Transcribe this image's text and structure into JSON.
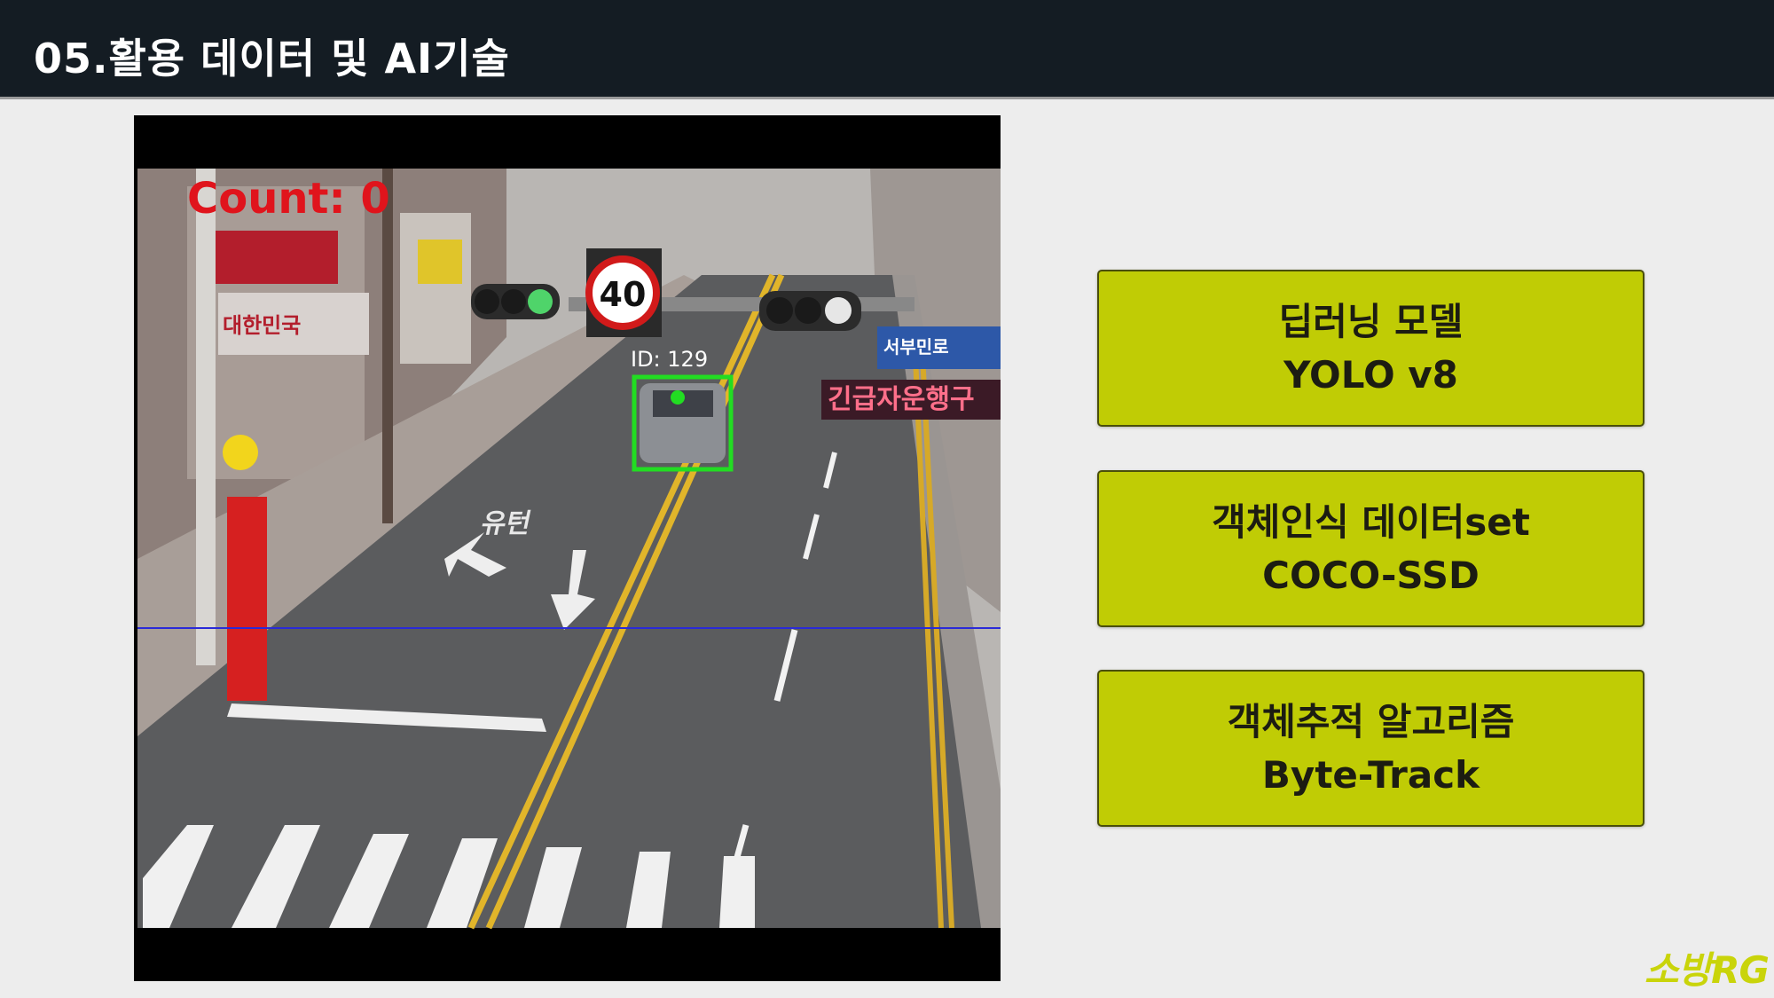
{
  "header": {
    "title": "05.활용 데이터 및 AI기술"
  },
  "video": {
    "overlay_count": "Count: 0",
    "track_id": "ID: 129",
    "speed_sign": "40",
    "road_marking": "유턴",
    "sign_emergency": "긴급자운행구",
    "sign_direction": "서부민로",
    "storefront_sign": "대한민국",
    "box_color": "#22dd22",
    "count_color": "#e0141c",
    "line_color": "#2a2ad8"
  },
  "cards": [
    {
      "line1": "딥러닝 모델",
      "line2": "YOLO v8"
    },
    {
      "line1": "객체인식 데이터set",
      "line2": "COCO-SSD"
    },
    {
      "line1": "객체추적 알고리즘",
      "line2": "Byte-Track"
    }
  ],
  "watermark": "소방RG"
}
